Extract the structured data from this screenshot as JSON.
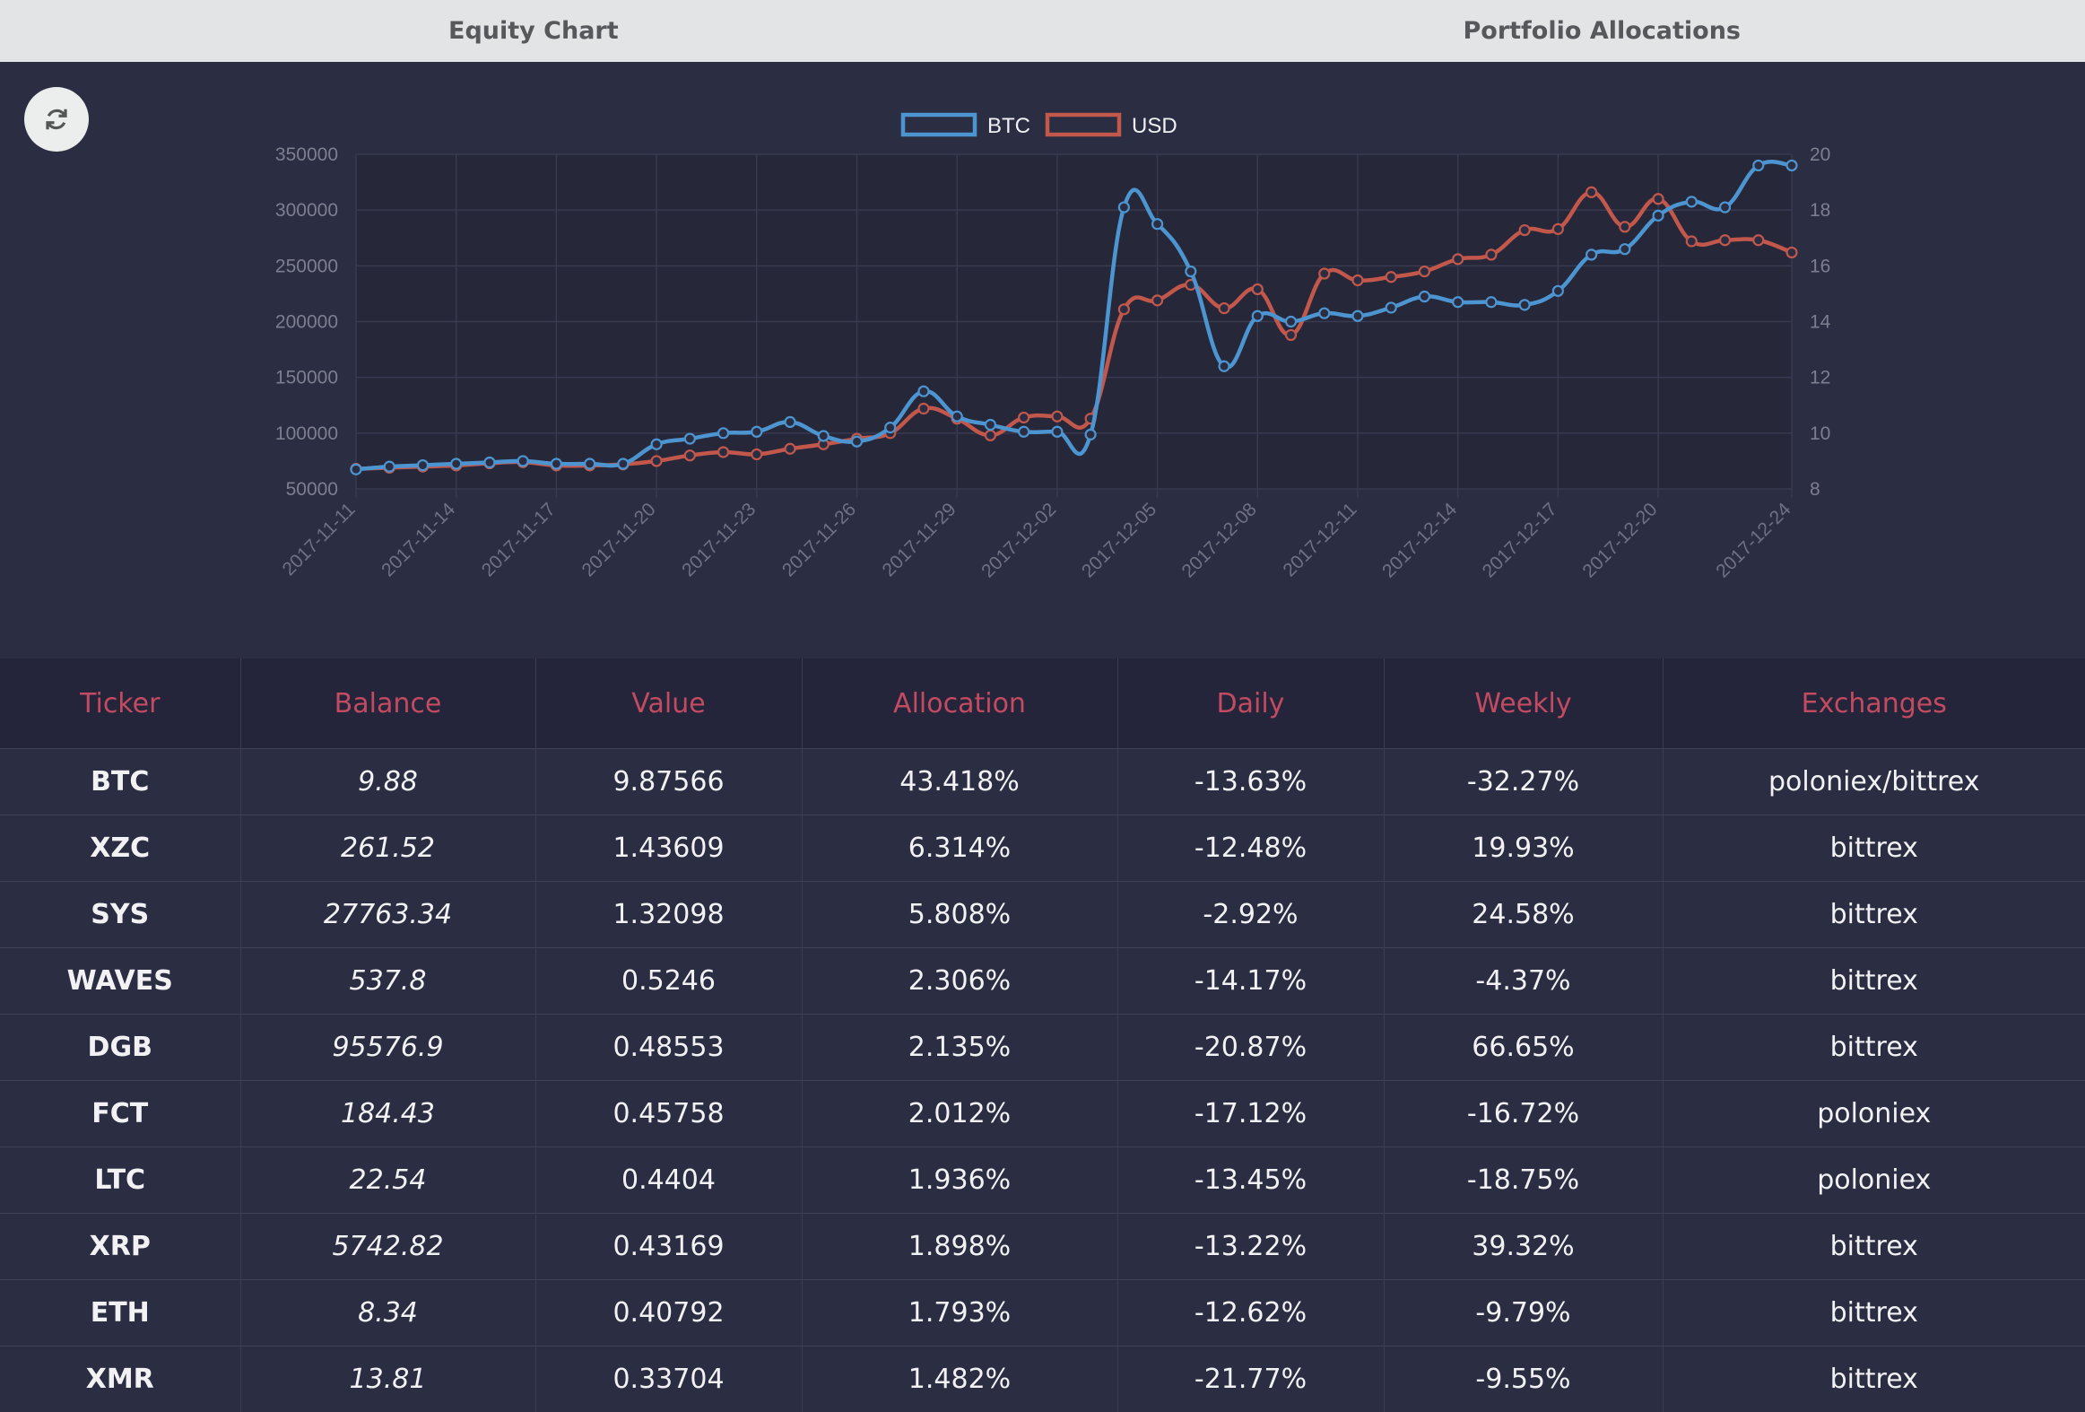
{
  "tabs": [
    {
      "label": "Equity Chart"
    },
    {
      "label": "Portfolio Allocations"
    }
  ],
  "refresh": {
    "icon": "refresh-icon"
  },
  "colors": {
    "btc": "#4d95d0",
    "usd": "#c2574c",
    "header_text": "#c24a61"
  },
  "chart_data": {
    "type": "line",
    "legend": [
      "BTC",
      "USD"
    ],
    "legend_position": "top-center",
    "grid": true,
    "x_ticks": [
      "2017-11-11",
      "2017-11-14",
      "2017-11-17",
      "2017-11-20",
      "2017-11-23",
      "2017-11-26",
      "2017-11-29",
      "2017-12-02",
      "2017-12-05",
      "2017-12-08",
      "2017-12-11",
      "2017-12-14",
      "2017-12-17",
      "2017-12-20",
      "2017-12-24"
    ],
    "x_range": [
      "2017-11-11",
      "2017-12-24"
    ],
    "y_left": {
      "ticks": [
        "350000",
        "300000",
        "250000",
        "200000",
        "150000",
        "100000",
        "50000"
      ],
      "range": [
        50000,
        350000
      ]
    },
    "y_right": {
      "ticks": [
        "20",
        "18",
        "16",
        "14",
        "12",
        "10",
        "8"
      ],
      "range": [
        8,
        20
      ]
    },
    "series": [
      {
        "name": "BTC",
        "axis": "right",
        "x": [
          "2017-11-11",
          "2017-11-12",
          "2017-11-13",
          "2017-11-14",
          "2017-11-15",
          "2017-11-16",
          "2017-11-17",
          "2017-11-18",
          "2017-11-19",
          "2017-11-20",
          "2017-11-21",
          "2017-11-22",
          "2017-11-23",
          "2017-11-24",
          "2017-11-25",
          "2017-11-26",
          "2017-11-27",
          "2017-11-28",
          "2017-11-29",
          "2017-11-30",
          "2017-12-01",
          "2017-12-02",
          "2017-12-03",
          "2017-12-04",
          "2017-12-05",
          "2017-12-06",
          "2017-12-07",
          "2017-12-08",
          "2017-12-09",
          "2017-12-10",
          "2017-12-11",
          "2017-12-12",
          "2017-12-13",
          "2017-12-14",
          "2017-12-15",
          "2017-12-16",
          "2017-12-17",
          "2017-12-18",
          "2017-12-19",
          "2017-12-20",
          "2017-12-21",
          "2017-12-22",
          "2017-12-23",
          "2017-12-24"
        ],
        "values": [
          8.7,
          8.8,
          8.85,
          8.9,
          8.95,
          9.0,
          8.9,
          8.9,
          8.9,
          9.6,
          9.8,
          10.0,
          10.05,
          10.4,
          9.9,
          9.7,
          10.2,
          11.5,
          10.6,
          10.3,
          10.05,
          10.05,
          9.95,
          18.1,
          17.5,
          15.8,
          12.4,
          14.2,
          14.0,
          14.3,
          14.2,
          14.5,
          14.9,
          14.7,
          14.7,
          14.6,
          15.1,
          16.4,
          16.6,
          17.8,
          18.3,
          18.1,
          19.6,
          19.6
        ]
      },
      {
        "name": "USD",
        "axis": "left",
        "x": [
          "2017-11-11",
          "2017-11-12",
          "2017-11-13",
          "2017-11-14",
          "2017-11-15",
          "2017-11-16",
          "2017-11-17",
          "2017-11-18",
          "2017-11-19",
          "2017-11-20",
          "2017-11-21",
          "2017-11-22",
          "2017-11-23",
          "2017-11-24",
          "2017-11-25",
          "2017-11-26",
          "2017-11-27",
          "2017-11-28",
          "2017-11-29",
          "2017-11-30",
          "2017-12-01",
          "2017-12-02",
          "2017-12-03",
          "2017-12-04",
          "2017-12-05",
          "2017-12-06",
          "2017-12-07",
          "2017-12-08",
          "2017-12-09",
          "2017-12-10",
          "2017-12-11",
          "2017-12-12",
          "2017-12-13",
          "2017-12-14",
          "2017-12-15",
          "2017-12-16",
          "2017-12-17",
          "2017-12-18",
          "2017-12-19",
          "2017-12-20",
          "2017-12-21",
          "2017-12-22",
          "2017-12-23",
          "2017-12-24"
        ],
        "values": [
          68000,
          69000,
          70000,
          71000,
          73000,
          74000,
          71000,
          71000,
          72000,
          75000,
          80000,
          83000,
          81000,
          86000,
          90000,
          95000,
          100000,
          122000,
          113000,
          98000,
          114000,
          115000,
          113000,
          211000,
          219000,
          233000,
          212000,
          229000,
          188000,
          243000,
          237000,
          240000,
          245000,
          256000,
          260000,
          282000,
          283000,
          316000,
          285000,
          310000,
          272000,
          273000,
          273000,
          262000
        ]
      }
    ]
  },
  "table": {
    "headers": [
      "Ticker",
      "Balance",
      "Value",
      "Allocation",
      "Daily",
      "Weekly",
      "Exchanges"
    ],
    "rows": [
      [
        "BTC",
        "9.88",
        "9.87566",
        "43.418%",
        "-13.63%",
        "-32.27%",
        "poloniex/bittrex"
      ],
      [
        "XZC",
        "261.52",
        "1.43609",
        "6.314%",
        "-12.48%",
        "19.93%",
        "bittrex"
      ],
      [
        "SYS",
        "27763.34",
        "1.32098",
        "5.808%",
        "-2.92%",
        "24.58%",
        "bittrex"
      ],
      [
        "WAVES",
        "537.8",
        "0.5246",
        "2.306%",
        "-14.17%",
        "-4.37%",
        "bittrex"
      ],
      [
        "DGB",
        "95576.9",
        "0.48553",
        "2.135%",
        "-20.87%",
        "66.65%",
        "bittrex"
      ],
      [
        "FCT",
        "184.43",
        "0.45758",
        "2.012%",
        "-17.12%",
        "-16.72%",
        "poloniex"
      ],
      [
        "LTC",
        "22.54",
        "0.4404",
        "1.936%",
        "-13.45%",
        "-18.75%",
        "poloniex"
      ],
      [
        "XRP",
        "5742.82",
        "0.43169",
        "1.898%",
        "-13.22%",
        "39.32%",
        "bittrex"
      ],
      [
        "ETH",
        "8.34",
        "0.40792",
        "1.793%",
        "-12.62%",
        "-9.79%",
        "bittrex"
      ],
      [
        "XMR",
        "13.81",
        "0.33704",
        "1.482%",
        "-21.77%",
        "-9.55%",
        "bittrex"
      ]
    ]
  }
}
